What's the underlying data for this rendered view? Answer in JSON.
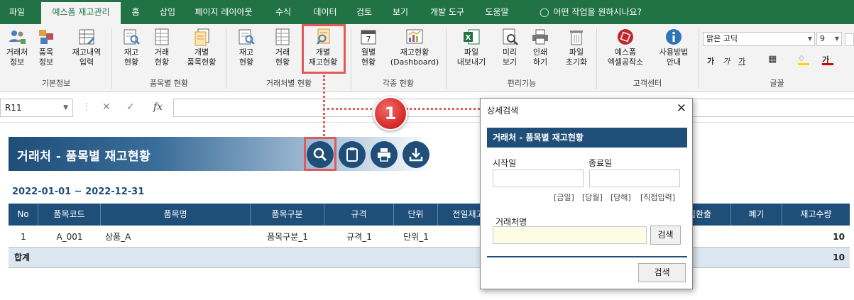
{
  "tabs": [
    "파일",
    "예스폼 재고관리",
    "홈",
    "삽입",
    "페이지 레이아웃",
    "수식",
    "데이터",
    "검토",
    "보기",
    "개발 도구",
    "도움말",
    "어떤 작업을 원하시나요?"
  ],
  "ribbon": {
    "groups": {
      "basic": "기본정보",
      "by_item": "품목별 현황",
      "by_client": "거래처별 현황",
      "various": "각종 현황",
      "convenience": "편리기능",
      "customer": "고객센터",
      "font": "글꼴"
    },
    "buttons": {
      "client_info": [
        "거래처",
        "정보"
      ],
      "item_info": [
        "품목",
        "정보"
      ],
      "stock_input": [
        "재고내역",
        "입력"
      ],
      "item_stock": [
        "재고",
        "현황"
      ],
      "item_trade": [
        "거래",
        "현황"
      ],
      "item_each": [
        "개별",
        "품목현황"
      ],
      "client_stock": [
        "재고",
        "현황"
      ],
      "client_trade": [
        "거래",
        "현황"
      ],
      "client_each": [
        "개별",
        "재고현황"
      ],
      "monthly": [
        "월별",
        "현황"
      ],
      "dashboard": [
        "재고현황",
        "(Dashboard)"
      ],
      "export": [
        "파일",
        "내보내기"
      ],
      "preview": [
        "미리",
        "보기"
      ],
      "print": [
        "인쇄",
        "하기"
      ],
      "reset": [
        "파일",
        "초기화"
      ],
      "yesform": [
        "예스폼",
        "엑셀공작소"
      ],
      "howto": [
        "사용방법",
        "안내"
      ]
    },
    "font": {
      "name": "맑은 고딕",
      "size": "9"
    }
  },
  "formula_bar": {
    "cell_ref": "R11",
    "formula": ""
  },
  "sheet": {
    "title": "거래처 - 품목별 재고현황",
    "date_range": "2022-01-01 ~ 2022-12-31",
    "columns": [
      "No",
      "품목코드",
      "품목명",
      "품목구분",
      "규격",
      "단위",
      "전일재고",
      "입환출",
      "폐기",
      "재고수량"
    ],
    "rows": [
      {
        "no": "1",
        "code": "A_001",
        "name": "상품_A",
        "category": "품목구분_1",
        "spec": "규격_1",
        "unit": "단위_1",
        "qty": "10"
      }
    ],
    "total": {
      "label": "합계",
      "qty": "10"
    }
  },
  "callout": {
    "number": "1"
  },
  "dialog": {
    "title": "상세검색",
    "close": "✕",
    "header": "거래처 - 품목별 재고현황",
    "start_label": "시작일",
    "end_label": "종료일",
    "start_value": "",
    "end_value": "",
    "links": [
      "[금일]",
      "[당월]",
      "[당해]",
      "[직접입력]"
    ],
    "client_label": "거래처명",
    "client_value": "",
    "search_small": "검색",
    "search_main": "검색"
  },
  "colors": {
    "excel_green": "#217346",
    "navy": "#1f4e79",
    "highlight": "#e05a5a"
  },
  "icons": [
    "users-icon",
    "boxes-icon",
    "ledger-icon",
    "doc-search-icon",
    "sheet-icon",
    "calendar-icon",
    "chart-icon",
    "excel-icon",
    "print-icon",
    "trash-icon",
    "stamp-icon",
    "info-icon",
    "search-icon",
    "clipboard-icon",
    "printer-icon",
    "download-icon"
  ]
}
